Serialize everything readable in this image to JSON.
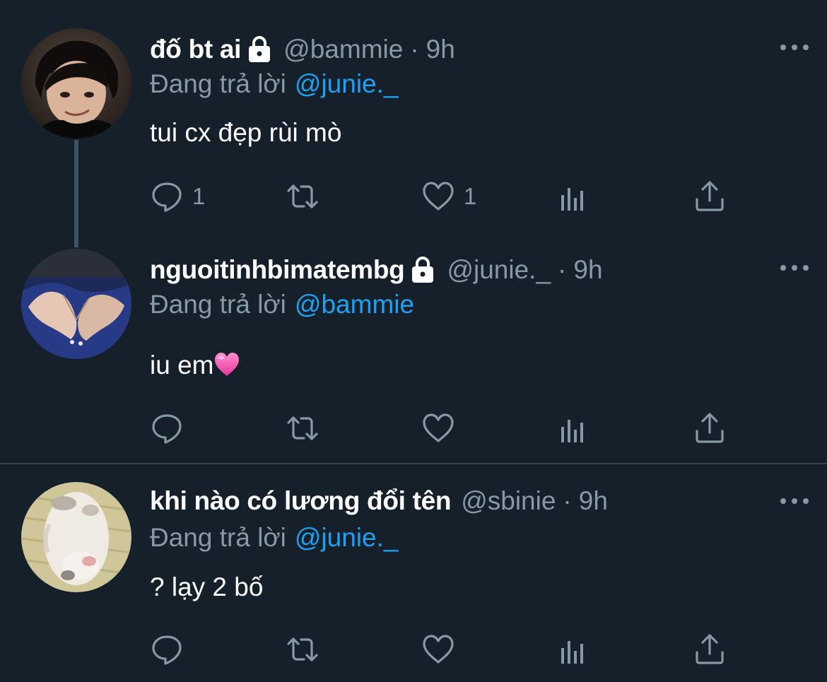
{
  "colors": {
    "background": "#15202b",
    "primary_text": "#ffffff",
    "secondary_text": "#8899a6",
    "link": "#1da1f2",
    "thread_line": "#3d5466",
    "divider": "#38444d"
  },
  "replying_prefix": "Đang trả lời",
  "icons": {
    "reply": "reply-icon",
    "retweet": "retweet-icon",
    "like": "like-icon",
    "analytics": "analytics-icon",
    "share": "share-icon",
    "more": "more-icon",
    "lock": "lock-icon"
  },
  "tweets": [
    {
      "display_name": "đố bt ai",
      "protected": true,
      "handle": "@bammie",
      "separator": "·",
      "time": "9h",
      "replying_to": "@junie._",
      "text": "tui cx đẹp rùi mò",
      "reply_count": "1",
      "like_count": "1"
    },
    {
      "display_name": "nguoitinhbimatembg",
      "protected": true,
      "handle": "@junie._",
      "separator": "·",
      "time": "9h",
      "replying_to": "@bammie",
      "text": "iu em",
      "emoji": "pink-heart",
      "reply_count": "",
      "like_count": ""
    },
    {
      "display_name": "khi nào có lương đổi tên",
      "protected": false,
      "handle": "@sbinie",
      "separator": "·",
      "time": "9h",
      "replying_to": "@junie._",
      "text": "? lạy 2 bố",
      "reply_count": "",
      "like_count": ""
    }
  ]
}
